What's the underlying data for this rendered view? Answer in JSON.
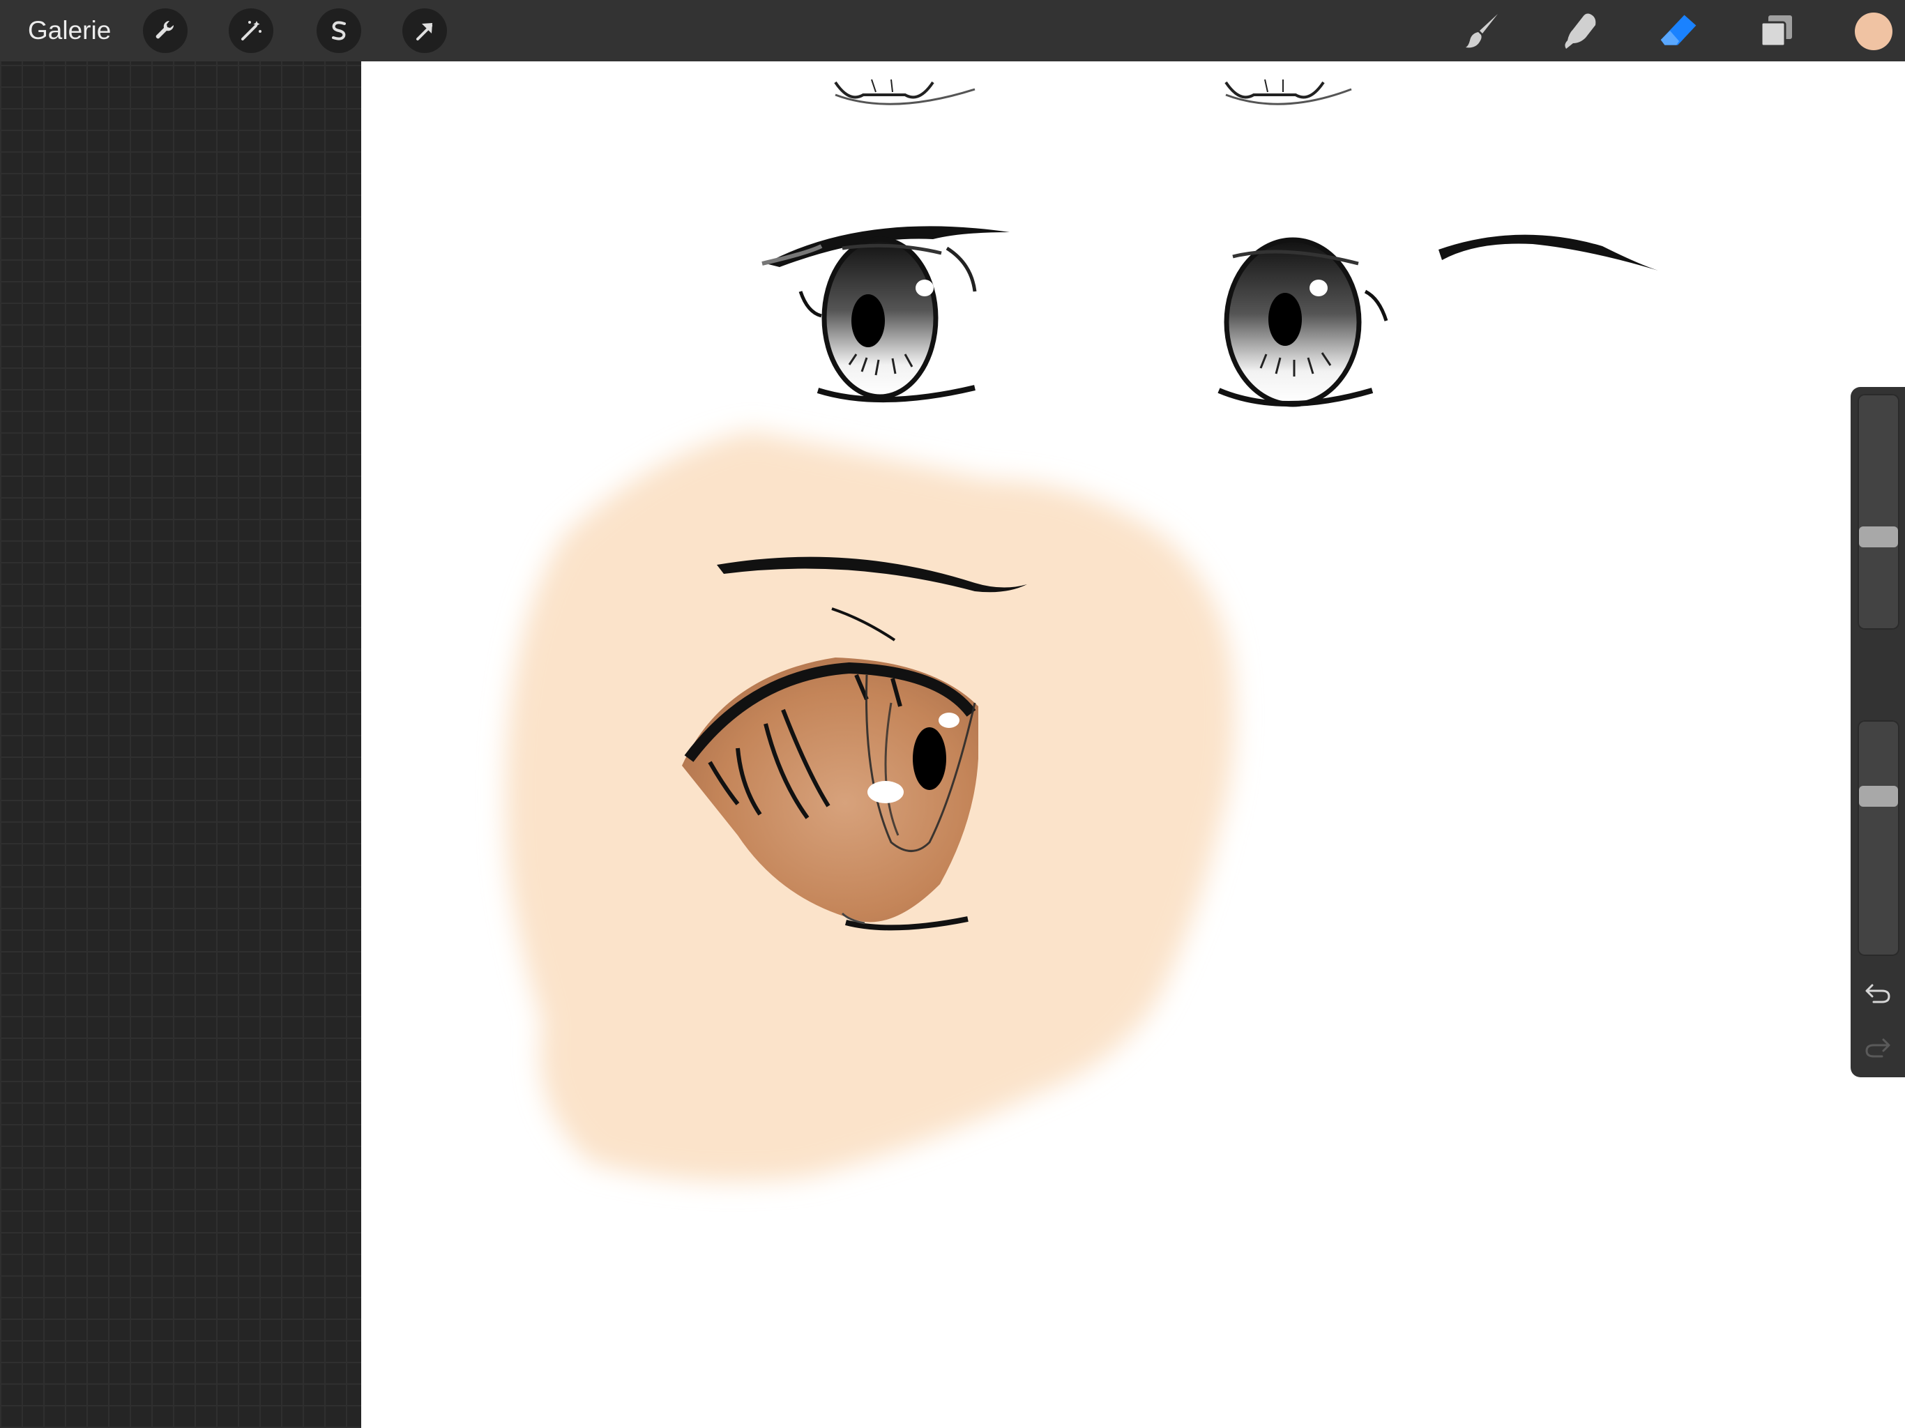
{
  "toolbar": {
    "gallery_label": "Galerie",
    "left_tools": [
      {
        "name": "actions",
        "icon": "wrench-icon"
      },
      {
        "name": "adjustments",
        "icon": "magic-wand-icon"
      },
      {
        "name": "selection",
        "icon": "selection-s-icon"
      },
      {
        "name": "transform",
        "icon": "arrow-cursor-icon"
      }
    ],
    "right_tools": [
      {
        "name": "brush",
        "icon": "brush-icon",
        "active": false
      },
      {
        "name": "smudge",
        "icon": "smudge-finger-icon",
        "active": false
      },
      {
        "name": "eraser",
        "icon": "eraser-icon",
        "active": true
      },
      {
        "name": "layers",
        "icon": "layers-icon",
        "active": false
      }
    ],
    "active_tool_color": "#1a82ff",
    "current_color": "#f0c3a3"
  },
  "sidebar": {
    "brush_size_level": 0.38,
    "opacity_level": 0.7,
    "undo_icon": "undo-arrow-icon",
    "redo_icon": "redo-arrow-icon"
  },
  "canvas": {
    "background": "#ffffff",
    "skin_color": "#fbe3ca",
    "iris_color": "#c98c63",
    "ink_color": "#111111"
  }
}
